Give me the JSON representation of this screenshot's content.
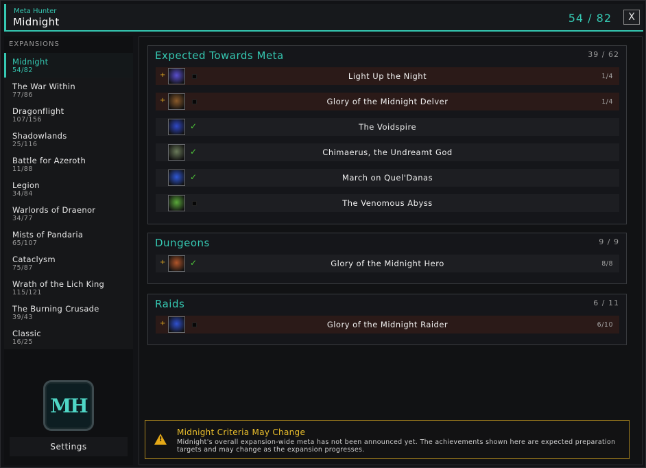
{
  "header": {
    "addon_name": "Meta Hunter",
    "title": "Midnight",
    "count": "54 / 82",
    "close_label": "X"
  },
  "sidebar": {
    "section_label": "EXPANSIONS",
    "items": [
      {
        "name": "Midnight",
        "progress": "54/82",
        "active": true
      },
      {
        "name": "The War Within",
        "progress": "77/86"
      },
      {
        "name": "Dragonflight",
        "progress": "107/156"
      },
      {
        "name": "Shadowlands",
        "progress": "25/116"
      },
      {
        "name": "Battle for Azeroth",
        "progress": "11/88"
      },
      {
        "name": "Legion",
        "progress": "34/84"
      },
      {
        "name": "Warlords of Draenor",
        "progress": "34/77"
      },
      {
        "name": "Mists of Pandaria",
        "progress": "65/107"
      },
      {
        "name": "Cataclysm",
        "progress": "75/87"
      },
      {
        "name": "Wrath of the Lich King",
        "progress": "115/121"
      },
      {
        "name": "The Burning Crusade",
        "progress": "39/43"
      },
      {
        "name": "Classic",
        "progress": "16/25"
      }
    ],
    "logo_text": "MH",
    "settings_label": "Settings"
  },
  "groups": [
    {
      "title": "Expected Towards Meta",
      "count": "39 / 62",
      "rows": [
        {
          "plus": "+",
          "name": "Light Up the Night",
          "progress": "1/4",
          "complete": false,
          "icon": "starburst-icon",
          "icon_color": "#5a4fd0"
        },
        {
          "plus": "+",
          "name": "Glory of the Midnight Delver",
          "progress": "1/4",
          "complete": false,
          "icon": "lantern-icon",
          "icon_color": "#8a5a2a"
        },
        {
          "plus": "",
          "name": "The Voidspire",
          "progress": "",
          "complete": true,
          "icon": "void-figure-icon",
          "icon_color": "#2f48c8"
        },
        {
          "plus": "",
          "name": "Chimaerus, the Undreamt God",
          "progress": "",
          "complete": true,
          "icon": "creature-icon",
          "icon_color": "#6a7a5a"
        },
        {
          "plus": "",
          "name": "March on Quel'Danas",
          "progress": "",
          "complete": true,
          "icon": "void-figure-icon",
          "icon_color": "#2f58d8"
        },
        {
          "plus": "",
          "name": "The Venomous Abyss",
          "progress": "",
          "complete": false,
          "icon": "venom-icon",
          "icon_color": "#5aa83a"
        }
      ]
    },
    {
      "title": "Dungeons",
      "count": "9 / 9",
      "rows": [
        {
          "plus": "+",
          "name": "Glory of the Midnight Hero",
          "progress": "8/8",
          "complete": true,
          "icon": "hero-crest-icon",
          "icon_color": "#b0552a"
        }
      ]
    },
    {
      "title": "Raids",
      "count": "6 / 11",
      "rows": [
        {
          "plus": "+",
          "name": "Glory of the Midnight Raider",
          "progress": "6/10",
          "complete": false,
          "icon": "raider-icon",
          "icon_color": "#2f50d0"
        }
      ]
    }
  ],
  "warning": {
    "title": "Midnight Criteria May Change",
    "text": "Midnight's overall expansion-wide meta has not been announced yet. The achievements shown here are expected preparation targets and may change as the expansion progresses."
  },
  "colors": {
    "accent": "#35c8b2",
    "incomplete_row": "#2b1a18",
    "warning_border": "#a9851e",
    "check": "#4fc83a"
  }
}
